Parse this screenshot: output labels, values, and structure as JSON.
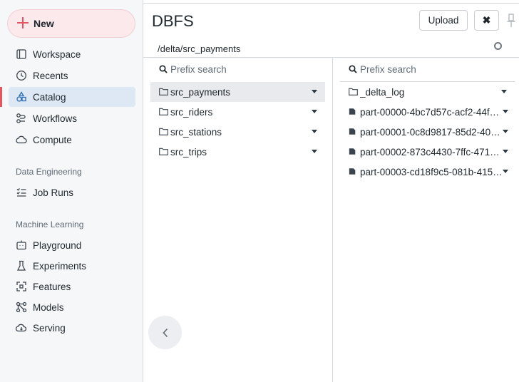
{
  "sidebar": {
    "new_label": "New",
    "nav": [
      {
        "label": "Workspace",
        "icon": "workspace-icon"
      },
      {
        "label": "Recents",
        "icon": "clock-icon"
      },
      {
        "label": "Catalog",
        "icon": "catalog-icon",
        "active": true
      },
      {
        "label": "Workflows",
        "icon": "workflows-icon"
      },
      {
        "label": "Compute",
        "icon": "cloud-icon"
      }
    ],
    "sections": [
      {
        "heading": "Data Engineering",
        "items": [
          {
            "label": "Job Runs",
            "icon": "job-runs-icon"
          }
        ]
      },
      {
        "heading": "Machine Learning",
        "items": [
          {
            "label": "Playground",
            "icon": "playground-icon"
          },
          {
            "label": "Experiments",
            "icon": "flask-icon"
          },
          {
            "label": "Features",
            "icon": "features-icon"
          },
          {
            "label": "Models",
            "icon": "models-icon"
          },
          {
            "label": "Serving",
            "icon": "serving-icon"
          }
        ]
      }
    ]
  },
  "dialog": {
    "title": "DBFS",
    "upload_label": "Upload",
    "close_label": "✖",
    "path": "/delta/src_payments"
  },
  "left_pane": {
    "search_placeholder": "Prefix search",
    "items": [
      {
        "name": "src_payments",
        "type": "folder",
        "selected": true
      },
      {
        "name": "src_riders",
        "type": "folder"
      },
      {
        "name": "src_stations",
        "type": "folder"
      },
      {
        "name": "src_trips",
        "type": "folder"
      }
    ]
  },
  "right_pane": {
    "search_placeholder": "Prefix search",
    "items": [
      {
        "name": "_delta_log",
        "type": "folder"
      },
      {
        "name": "part-00000-4bc7d57c-acf2-44f…",
        "type": "file"
      },
      {
        "name": "part-00001-0c8d9817-85d2-40…",
        "type": "file"
      },
      {
        "name": "part-00002-873c4430-7ffc-471…",
        "type": "file"
      },
      {
        "name": "part-00003-cd18f9c5-081b-415…",
        "type": "file"
      }
    ]
  },
  "colors": {
    "accent": "#e4565f",
    "active_bg": "#dde8f4",
    "selected_row": "#e8eaed"
  }
}
